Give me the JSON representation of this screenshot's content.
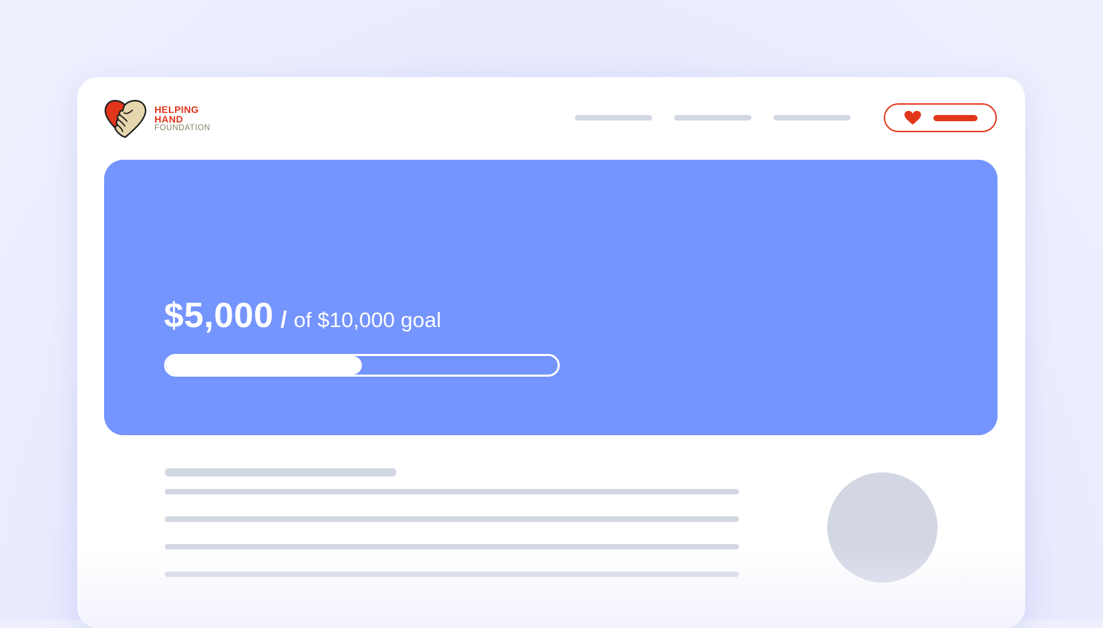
{
  "brand": {
    "line1": "HELPING",
    "line2": "HAND",
    "line3": "FOUNDATION",
    "logo_icon": "heart-handshake-icon"
  },
  "nav": {
    "items": [
      "placeholder",
      "placeholder",
      "placeholder"
    ]
  },
  "donate_button": {
    "icon": "heart-icon"
  },
  "campaign": {
    "raised": "$5,000",
    "separator": "/",
    "goal_text": "of $10,000 goal",
    "progress_fraction": 0.5
  },
  "colors": {
    "accent": "#e2361b",
    "hero": "#7494fe",
    "placeholder": "#d3d7e3"
  }
}
